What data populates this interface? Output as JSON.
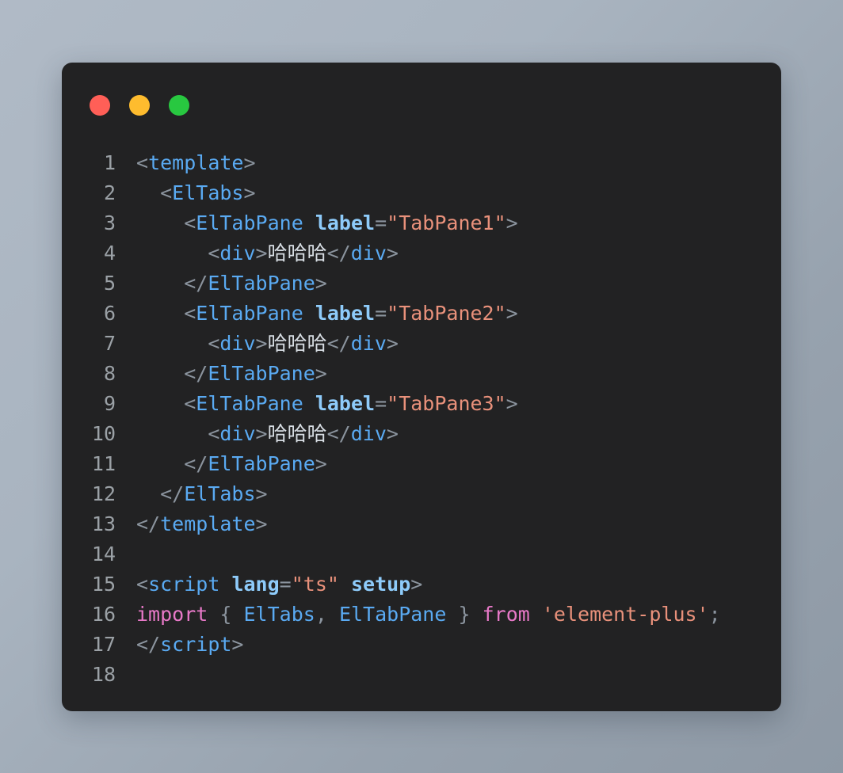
{
  "window": {
    "title": "",
    "controls": [
      {
        "name": "close",
        "color": "#ff5f57"
      },
      {
        "name": "minimize",
        "color": "#febc2e"
      },
      {
        "name": "maximize",
        "color": "#28c840"
      }
    ],
    "background": "#222223",
    "page_background": "#a9b4c0"
  },
  "editor": {
    "language": "vue",
    "total_lines": 18,
    "lines": [
      {
        "n": "1",
        "tokens": [
          {
            "t": "punc",
            "v": "<"
          },
          {
            "t": "tag",
            "v": "template"
          },
          {
            "t": "punc",
            "v": ">"
          }
        ]
      },
      {
        "n": "2",
        "tokens": [
          {
            "t": "plain",
            "v": "  "
          },
          {
            "t": "punc",
            "v": "<"
          },
          {
            "t": "tag",
            "v": "ElTabs"
          },
          {
            "t": "punc",
            "v": ">"
          }
        ]
      },
      {
        "n": "3",
        "tokens": [
          {
            "t": "plain",
            "v": "    "
          },
          {
            "t": "punc",
            "v": "<"
          },
          {
            "t": "tag",
            "v": "ElTabPane"
          },
          {
            "t": "plain",
            "v": " "
          },
          {
            "t": "attr",
            "v": "label"
          },
          {
            "t": "punc",
            "v": "="
          },
          {
            "t": "str",
            "v": "\"TabPane1\""
          },
          {
            "t": "punc",
            "v": ">"
          }
        ]
      },
      {
        "n": "4",
        "tokens": [
          {
            "t": "plain",
            "v": "      "
          },
          {
            "t": "punc",
            "v": "<"
          },
          {
            "t": "tag",
            "v": "div"
          },
          {
            "t": "punc",
            "v": ">"
          },
          {
            "t": "text",
            "v": "哈哈哈"
          },
          {
            "t": "punc",
            "v": "</"
          },
          {
            "t": "tag",
            "v": "div"
          },
          {
            "t": "punc",
            "v": ">"
          }
        ]
      },
      {
        "n": "5",
        "tokens": [
          {
            "t": "plain",
            "v": "    "
          },
          {
            "t": "punc",
            "v": "</"
          },
          {
            "t": "tag",
            "v": "ElTabPane"
          },
          {
            "t": "punc",
            "v": ">"
          }
        ]
      },
      {
        "n": "6",
        "tokens": [
          {
            "t": "plain",
            "v": "    "
          },
          {
            "t": "punc",
            "v": "<"
          },
          {
            "t": "tag",
            "v": "ElTabPane"
          },
          {
            "t": "plain",
            "v": " "
          },
          {
            "t": "attr",
            "v": "label"
          },
          {
            "t": "punc",
            "v": "="
          },
          {
            "t": "str",
            "v": "\"TabPane2\""
          },
          {
            "t": "punc",
            "v": ">"
          }
        ]
      },
      {
        "n": "7",
        "tokens": [
          {
            "t": "plain",
            "v": "      "
          },
          {
            "t": "punc",
            "v": "<"
          },
          {
            "t": "tag",
            "v": "div"
          },
          {
            "t": "punc",
            "v": ">"
          },
          {
            "t": "text",
            "v": "哈哈哈"
          },
          {
            "t": "punc",
            "v": "</"
          },
          {
            "t": "tag",
            "v": "div"
          },
          {
            "t": "punc",
            "v": ">"
          }
        ]
      },
      {
        "n": "8",
        "tokens": [
          {
            "t": "plain",
            "v": "    "
          },
          {
            "t": "punc",
            "v": "</"
          },
          {
            "t": "tag",
            "v": "ElTabPane"
          },
          {
            "t": "punc",
            "v": ">"
          }
        ]
      },
      {
        "n": "9",
        "tokens": [
          {
            "t": "plain",
            "v": "    "
          },
          {
            "t": "punc",
            "v": "<"
          },
          {
            "t": "tag",
            "v": "ElTabPane"
          },
          {
            "t": "plain",
            "v": " "
          },
          {
            "t": "attr",
            "v": "label"
          },
          {
            "t": "punc",
            "v": "="
          },
          {
            "t": "str",
            "v": "\"TabPane3\""
          },
          {
            "t": "punc",
            "v": ">"
          }
        ]
      },
      {
        "n": "10",
        "tokens": [
          {
            "t": "plain",
            "v": "      "
          },
          {
            "t": "punc",
            "v": "<"
          },
          {
            "t": "tag",
            "v": "div"
          },
          {
            "t": "punc",
            "v": ">"
          },
          {
            "t": "text",
            "v": "哈哈哈"
          },
          {
            "t": "punc",
            "v": "</"
          },
          {
            "t": "tag",
            "v": "div"
          },
          {
            "t": "punc",
            "v": ">"
          }
        ]
      },
      {
        "n": "11",
        "tokens": [
          {
            "t": "plain",
            "v": "    "
          },
          {
            "t": "punc",
            "v": "</"
          },
          {
            "t": "tag",
            "v": "ElTabPane"
          },
          {
            "t": "punc",
            "v": ">"
          }
        ]
      },
      {
        "n": "12",
        "tokens": [
          {
            "t": "plain",
            "v": "  "
          },
          {
            "t": "punc",
            "v": "</"
          },
          {
            "t": "tag",
            "v": "ElTabs"
          },
          {
            "t": "punc",
            "v": ">"
          }
        ]
      },
      {
        "n": "13",
        "tokens": [
          {
            "t": "punc",
            "v": "</"
          },
          {
            "t": "tag",
            "v": "template"
          },
          {
            "t": "punc",
            "v": ">"
          }
        ]
      },
      {
        "n": "14",
        "tokens": []
      },
      {
        "n": "15",
        "tokens": [
          {
            "t": "punc",
            "v": "<"
          },
          {
            "t": "tag",
            "v": "script"
          },
          {
            "t": "plain",
            "v": " "
          },
          {
            "t": "attr",
            "v": "lang"
          },
          {
            "t": "punc",
            "v": "="
          },
          {
            "t": "str",
            "v": "\"ts\""
          },
          {
            "t": "plain",
            "v": " "
          },
          {
            "t": "attr",
            "v": "setup"
          },
          {
            "t": "punc",
            "v": ">"
          }
        ]
      },
      {
        "n": "16",
        "tokens": [
          {
            "t": "kw",
            "v": "import"
          },
          {
            "t": "plain",
            "v": " "
          },
          {
            "t": "punc",
            "v": "{"
          },
          {
            "t": "plain",
            "v": " "
          },
          {
            "t": "ident",
            "v": "ElTabs"
          },
          {
            "t": "punc",
            "v": ","
          },
          {
            "t": "plain",
            "v": " "
          },
          {
            "t": "ident",
            "v": "ElTabPane"
          },
          {
            "t": "plain",
            "v": " "
          },
          {
            "t": "punc",
            "v": "}"
          },
          {
            "t": "plain",
            "v": " "
          },
          {
            "t": "kw",
            "v": "from"
          },
          {
            "t": "plain",
            "v": " "
          },
          {
            "t": "str",
            "v": "'element-plus'"
          },
          {
            "t": "punc",
            "v": ";"
          }
        ]
      },
      {
        "n": "17",
        "tokens": [
          {
            "t": "punc",
            "v": "</"
          },
          {
            "t": "tag",
            "v": "script"
          },
          {
            "t": "punc",
            "v": ">"
          }
        ]
      },
      {
        "n": "18",
        "tokens": []
      }
    ]
  }
}
